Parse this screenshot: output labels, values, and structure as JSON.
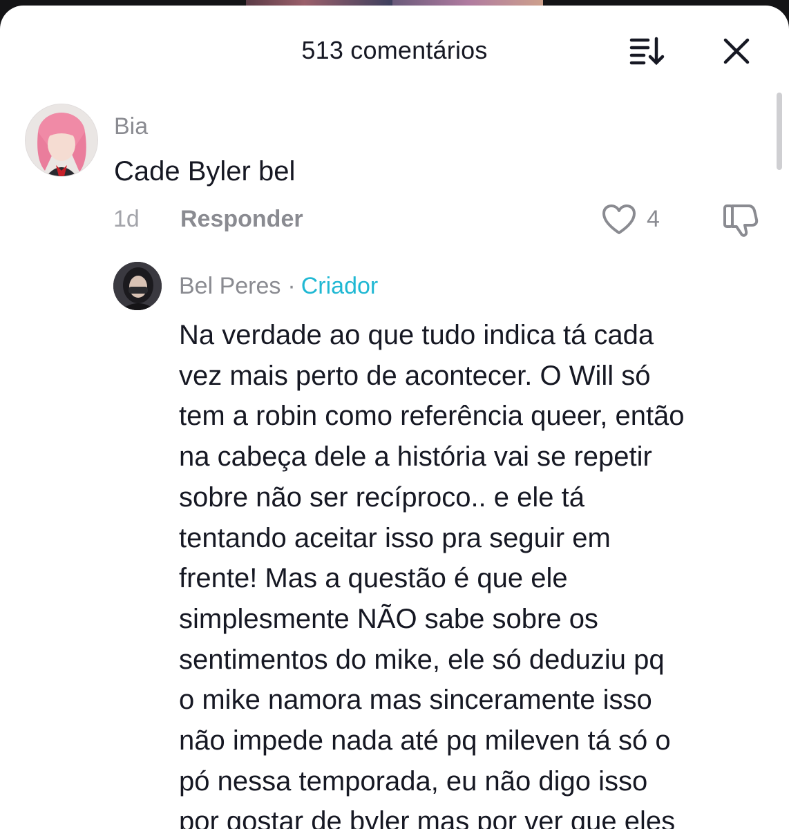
{
  "header": {
    "title": "513 comentários",
    "sort_icon": "sort-icon",
    "close_icon": "close-icon"
  },
  "comment": {
    "username": "Bia",
    "text": "Cade Byler bel",
    "time": "1d",
    "reply_label": "Responder",
    "like_count": "4",
    "like_icon": "heart-icon",
    "dislike_icon": "thumbs-down-icon"
  },
  "reply": {
    "username": "Bel Peres",
    "separator": "·",
    "badge": "Criador",
    "text": "Na verdade ao que tudo indica tá cada\nvez mais perto de acontecer. O Will só\ntem a robin como referência queer, então\nna cabeça dele a história vai se repetir\nsobre não ser recíproco.. e ele tá\ntentando aceitar isso pra seguir em\nfrente! Mas a questão é que ele\nsimplesmente NÃO sabe sobre os\nsentimentos do mike, ele só deduziu pq\no mike namora mas sinceramente isso\nnão impede nada até pq mileven tá só o\npó nessa temporada, eu não digo isso\npor gostar de byler mas por ver que eles"
  },
  "colors": {
    "primary_text": "#161823",
    "secondary_text": "#8a8b91",
    "creator_accent": "#20b8d3",
    "sheet_background": "#ffffff"
  }
}
